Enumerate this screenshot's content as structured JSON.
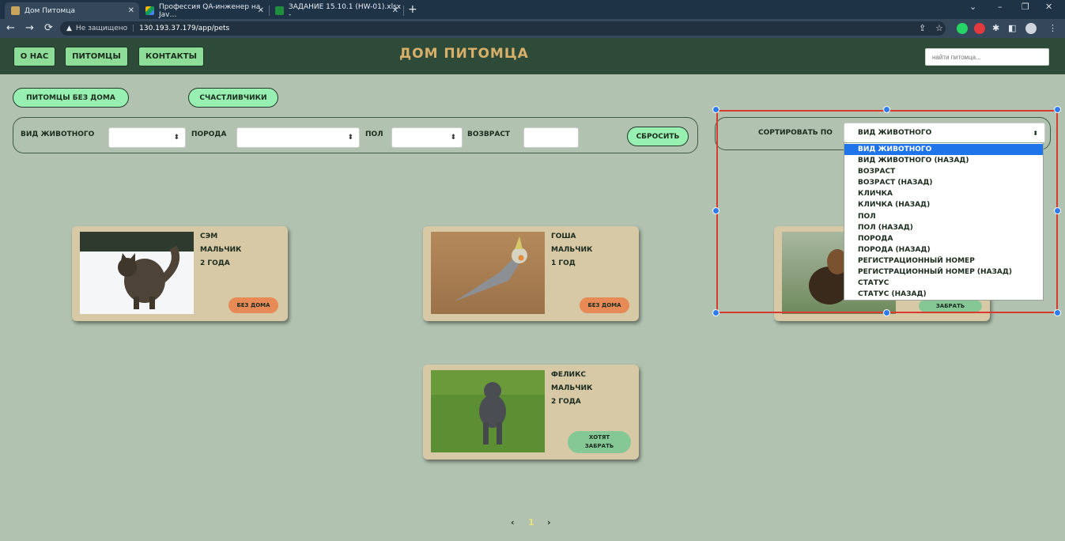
{
  "browser": {
    "tabs": [
      {
        "title": "Дом Питомца"
      },
      {
        "title": "Профессия QA-инженер на Jav…"
      },
      {
        "title": "ЗАДАНИЕ 15.10.1 (HW-01).xlsx -"
      }
    ],
    "new_tab": "+",
    "security_label": "Не защищено",
    "url": "130.193.37.179/app/pets",
    "window_controls": [
      "⌄",
      "–",
      "❐",
      "✕"
    ],
    "nav": {
      "back": "←",
      "forward": "→",
      "reload": "⟳"
    },
    "icons": {
      "share": "⇪",
      "bookmark": "☆",
      "extensions": "✱",
      "sidebar": "◧",
      "menu": "⋮"
    },
    "colors": {
      "whatsapp": "#25d366",
      "adblock": "#e0393e"
    }
  },
  "header": {
    "nav": [
      "О НАС",
      "ПИТОМЦЫ",
      "КОНТАКТЫ"
    ],
    "title": "ДОМ ПИТОМЦА",
    "search_placeholder": "найти питомца..."
  },
  "filters": {
    "tabs": [
      "ПИТОМЦЫ БЕЗ ДОМА",
      "СЧАСТЛИВЧИКИ"
    ],
    "animal_label": "ВИД ЖИВОТНОГО",
    "breed_label": "ПОРОДА",
    "sex_label": "ПОЛ",
    "age_label": "ВОЗВРАСТ",
    "select_arrow": "⬍",
    "reset": "СБРОСИТЬ"
  },
  "sort": {
    "label": "СОРТИРОВАТЬ ПО",
    "selected": "ВИД ЖИВОТНОГО",
    "arrow": "⬍",
    "options": [
      "ВИД ЖИВОТНОГО",
      "ВИД ЖИВОТНОГО (НАЗАД)",
      "ВОЗРАСТ",
      "ВОЗРАСТ (НАЗАД)",
      "КЛИЧКА",
      "КЛИЧКА (НАЗАД)",
      "ПОЛ",
      "ПОЛ (НАЗАД)",
      "ПОРОДА",
      "ПОРОДА (НАЗАД)",
      "РЕГИСТРАЦИОННЫЙ НОМЕР",
      "РЕГИСТРАЦИОННЫЙ НОМЕР (НАЗАД)",
      "СТАТУС",
      "СТАТУС (НАЗАД)"
    ]
  },
  "pets": [
    {
      "name": "СЭМ",
      "sex": "МАЛЬЧИК",
      "age": "2 ГОДА",
      "status": "БЕЗ ДОМА"
    },
    {
      "name": "ГОША",
      "sex": "МАЛЬЧИК",
      "age": "1 ГОД",
      "status": "БЕЗ ДОМА"
    },
    {
      "name": "",
      "sex": "",
      "age": "",
      "status": "ЗАБРАТЬ"
    },
    {
      "name": "ФЕЛИКС",
      "sex": "МАЛЬЧИК",
      "age": "2 ГОДА",
      "status": "ХОТЯТ ЗАБРАТЬ",
      "status_lines": [
        "ХОТЯТ",
        "ЗАБРАТЬ"
      ]
    }
  ],
  "pagination": {
    "prev": "‹",
    "current": "1",
    "next": "›"
  }
}
